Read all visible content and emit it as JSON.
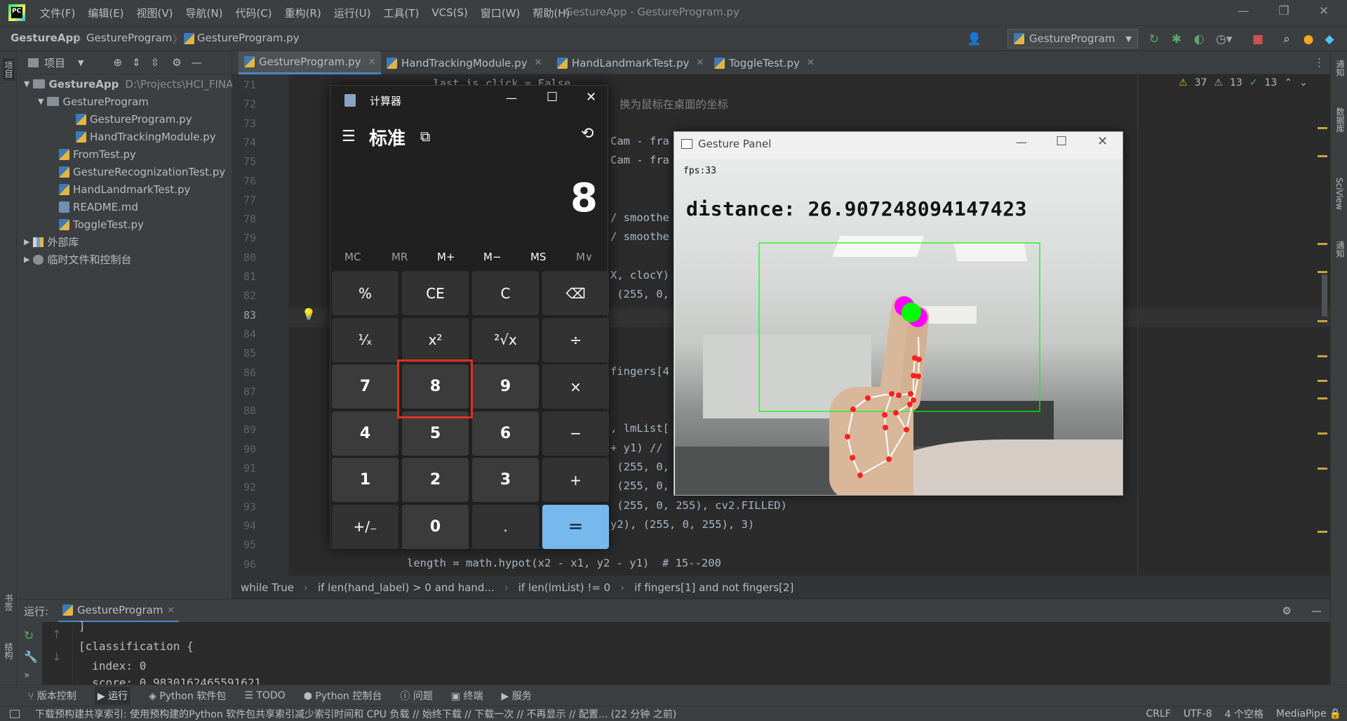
{
  "window_title": "GestureApp - GestureProgram.py",
  "menu": [
    "文件(F)",
    "编辑(E)",
    "视图(V)",
    "导航(N)",
    "代码(C)",
    "重构(R)",
    "运行(U)",
    "工具(T)",
    "VCS(S)",
    "窗口(W)",
    "帮助(H)"
  ],
  "breadcrumb": {
    "project": "GestureApp",
    "folder": "GestureProgram",
    "file": "GestureProgram.py"
  },
  "run_config": "GestureProgram",
  "left_tabs": {
    "project": "项目",
    "bookmarks": "书签",
    "structure": "结构"
  },
  "right_tabs": {
    "notifications": "通知",
    "database": "数据库",
    "sciview": "SciView",
    "notify": "通知"
  },
  "project_panel": {
    "title": "项目",
    "items": [
      {
        "label": "GestureApp",
        "path": "D:\\Projects\\HCI_FINA",
        "type": "folder"
      },
      {
        "label": "GestureProgram",
        "type": "folder"
      },
      {
        "label": "GestureProgram.py",
        "type": "py"
      },
      {
        "label": "HandTrackingModule.py",
        "type": "py"
      },
      {
        "label": "FromTest.py",
        "type": "py"
      },
      {
        "label": "GestureRecognizationTest.py",
        "type": "py"
      },
      {
        "label": "HandLandmarkTest.py",
        "type": "py"
      },
      {
        "label": "README.md",
        "type": "md"
      },
      {
        "label": "ToggleTest.py",
        "type": "py"
      },
      {
        "label": "外部库",
        "type": "lib"
      },
      {
        "label": "临时文件和控制台",
        "type": "scratch"
      }
    ]
  },
  "editor_tabs": [
    "GestureProgram.py",
    "HandTrackingModule.py",
    "HandLandmarkTest.py",
    "ToggleTest.py"
  ],
  "inspections": {
    "warnings": "37",
    "weak": "13",
    "ok": "13"
  },
  "line_numbers": [
    "71",
    "72",
    "73",
    "74",
    "75",
    "76",
    "77",
    "78",
    "79",
    "80",
    "81",
    "82",
    "83",
    "84",
    "85",
    "86",
    "87",
    "88",
    "89",
    "90",
    "91",
    "92",
    "93",
    "94",
    "95",
    "96"
  ],
  "code_lines": [
    {
      "t": "    last_is_click = False"
    },
    {
      "t": "换为鼠标在桌面的坐标"
    },
    {
      "t": ""
    },
    {
      "t": "Cam - fra"
    },
    {
      "t": "Cam - fra"
    },
    {
      "t": ""
    },
    {
      "t": ""
    },
    {
      "t": "/ smoothe"
    },
    {
      "t": "/ smoothe"
    },
    {
      "t": ""
    },
    {
      "t": "X, clocY)"
    },
    {
      "t": " (255, 0,"
    },
    {
      "t": ""
    },
    {
      "t": ""
    },
    {
      "t": ""
    },
    {
      "t": "fingers[4"
    },
    {
      "t": ""
    },
    {
      "t": ""
    },
    {
      "t": ", lmList["
    },
    {
      "t": "+ y1) //"
    },
    {
      "t": " (255, 0,"
    },
    {
      "t": " (255, 0,"
    },
    {
      "t": " (255, 0, 255), cv2.FILLED)"
    },
    {
      "t": "y2), (255, 0, 255), 3)"
    },
    {
      "t": ""
    },
    {
      "t": "length = math.hypot(x2 - x1, y2 - y1)  # 15--200"
    }
  ],
  "code_crumbs": [
    "while True",
    "if len(hand_label) > 0 and hand...",
    "if len(lmList) != 0",
    "if fingers[1] and not fingers[2]"
  ],
  "run_panel": {
    "label": "运行:",
    "tab": "GestureProgram",
    "output": [
      "]",
      "[classification {",
      "  index: 0",
      "  score: 0.9830162465591621"
    ]
  },
  "tool_tabs": [
    "版本控制",
    "运行",
    "Python 软件包",
    "TODO",
    "Python 控制台",
    "问题",
    "终端",
    "服务"
  ],
  "status": {
    "message": "下载预构建共享索引: 使用预构建的Python 软件包共享索引减少索引时间和 CPU 负载 // 始终下载 // 下载一次 // 不再显示 // 配置... (22 分钟 之前)",
    "line_sep": "CRLF",
    "encoding": "UTF-8",
    "indent": "4 个空格",
    "interpreter": "MediaPipe"
  },
  "calculator": {
    "title": "计算器",
    "mode": "标准",
    "display": "8",
    "memory": [
      "MC",
      "MR",
      "M+",
      "M−",
      "MS",
      "M∨"
    ],
    "keys": [
      [
        "%",
        "CE",
        "C",
        "⌫"
      ],
      [
        "¹⁄ₓ",
        "x²",
        "²√x",
        "÷"
      ],
      [
        "7",
        "8",
        "9",
        "×"
      ],
      [
        "4",
        "5",
        "6",
        "−"
      ],
      [
        "1",
        "2",
        "3",
        "+"
      ],
      [
        "+/₋",
        "0",
        ".",
        "="
      ]
    ],
    "highlighted_key": "8"
  },
  "gesture_panel": {
    "title": "Gesture Panel",
    "fps": "fps:33",
    "distance": "distance: 26.907248094147423"
  },
  "colors": {
    "accent": "#76b9ed",
    "highlight_box": "#e0311f",
    "roi": "#00ff00",
    "landmark": "#ff0000",
    "pinch": "#ff00ff",
    "cursor": "#00ff00"
  }
}
